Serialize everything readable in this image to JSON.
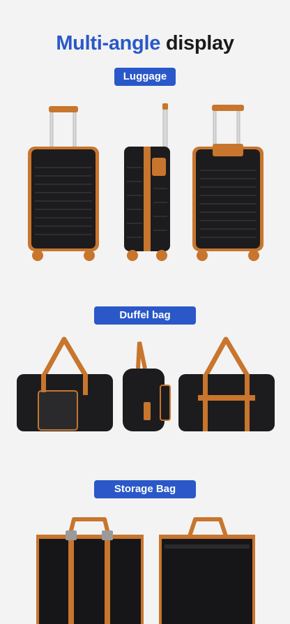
{
  "header": {
    "title_accent": "Multi-angle",
    "title_rest": "display"
  },
  "sections": {
    "luggage": {
      "label": "Luggage"
    },
    "duffel": {
      "label": "Duffel bag"
    },
    "storage": {
      "label": "Storage Bag"
    }
  },
  "colors": {
    "accent": "#2a58c9",
    "shell": "#1c1c1e",
    "trim": "#c8752d",
    "background": "#f3f3f3"
  }
}
